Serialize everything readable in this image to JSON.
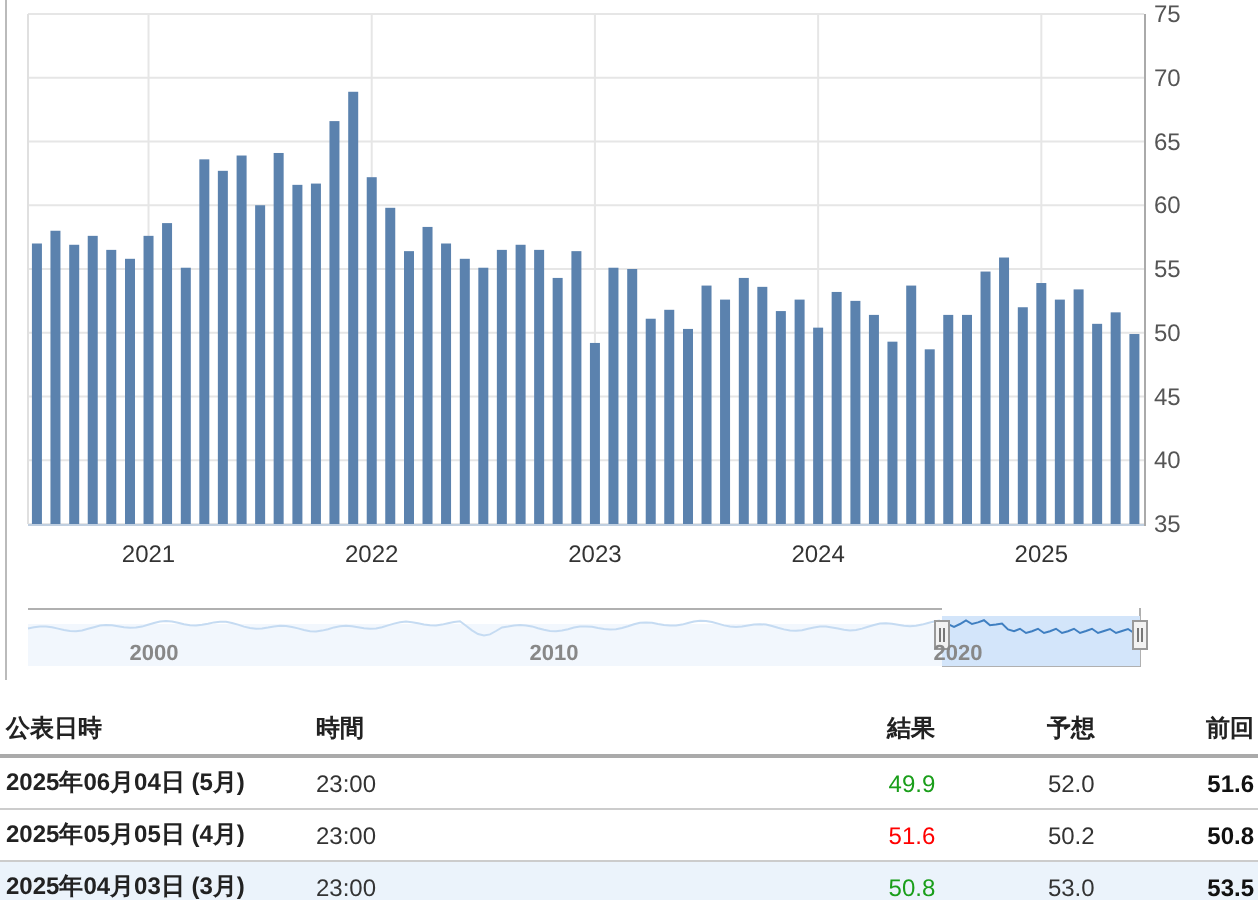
{
  "chart": {
    "chart_data": {
      "type": "bar",
      "x": [
        2020.5,
        2020.583,
        2020.667,
        2020.75,
        2020.833,
        2020.917,
        2021,
        2021.083,
        2021.167,
        2021.25,
        2021.333,
        2021.417,
        2021.5,
        2021.583,
        2021.667,
        2021.75,
        2021.833,
        2021.917,
        2022,
        2022.083,
        2022.167,
        2022.25,
        2022.333,
        2022.417,
        2022.5,
        2022.583,
        2022.667,
        2022.75,
        2022.833,
        2022.917,
        2023,
        2023.083,
        2023.167,
        2023.25,
        2023.333,
        2023.417,
        2023.5,
        2023.583,
        2023.667,
        2023.75,
        2023.833,
        2023.917,
        2024,
        2024.083,
        2024.167,
        2024.25,
        2024.333,
        2024.417,
        2024.5,
        2024.583,
        2024.667,
        2024.75,
        2024.833,
        2024.917,
        2025,
        2025.083,
        2025.167,
        2025.25,
        2025.333,
        2025.417
      ],
      "grid": true,
      "xlim": [
        2020.46,
        2025.46
      ],
      "series": [
        {
          "color": "#5b82ae",
          "values": [
            57.0,
            58.0,
            56.9,
            57.6,
            56.5,
            55.8,
            57.6,
            58.6,
            55.1,
            63.6,
            62.7,
            63.9,
            60.0,
            64.1,
            61.6,
            61.7,
            66.6,
            68.9,
            62.2,
            59.8,
            56.4,
            58.3,
            57.0,
            55.8,
            55.1,
            56.5,
            56.9,
            56.5,
            54.3,
            56.4,
            49.2,
            55.1,
            55.0,
            51.1,
            51.8,
            50.3,
            53.7,
            52.6,
            54.3,
            53.6,
            51.7,
            52.6,
            50.4,
            53.2,
            52.5,
            51.4,
            49.3,
            53.7,
            48.7,
            51.4,
            51.4,
            54.8,
            55.9,
            52.0,
            53.9,
            52.6,
            53.4,
            50.7,
            51.6,
            49.9
          ]
        }
      ],
      "xticks": [
        2021,
        2022,
        2023,
        2024,
        2025
      ],
      "ylim": [
        35,
        75
      ],
      "yticks": [
        35,
        40,
        45,
        50,
        55,
        60,
        65,
        70,
        75
      ]
    }
  },
  "navigator": {
    "labels": [
      "2000",
      "2010",
      "2020"
    ]
  },
  "table": {
    "columns": [
      "公表日時",
      "時間",
      "結果",
      "予想",
      "前回"
    ],
    "rows": [
      {
        "date": "2025年06月04日 (5月)",
        "time": "23:00",
        "actual": "49.9",
        "color": "#1a9e1a",
        "forecast": "52.0",
        "previous": "51.6",
        "selected": false
      },
      {
        "date": "2025年05月05日 (4月)",
        "time": "23:00",
        "actual": "51.6",
        "color": "#ff0000",
        "forecast": "50.2",
        "previous": "50.8",
        "selected": false
      },
      {
        "date": "2025年04月03日 (3月)",
        "time": "23:00",
        "actual": "50.8",
        "color": "#1a9e1a",
        "forecast": "53.0",
        "previous": "53.5",
        "selected": true
      }
    ]
  }
}
